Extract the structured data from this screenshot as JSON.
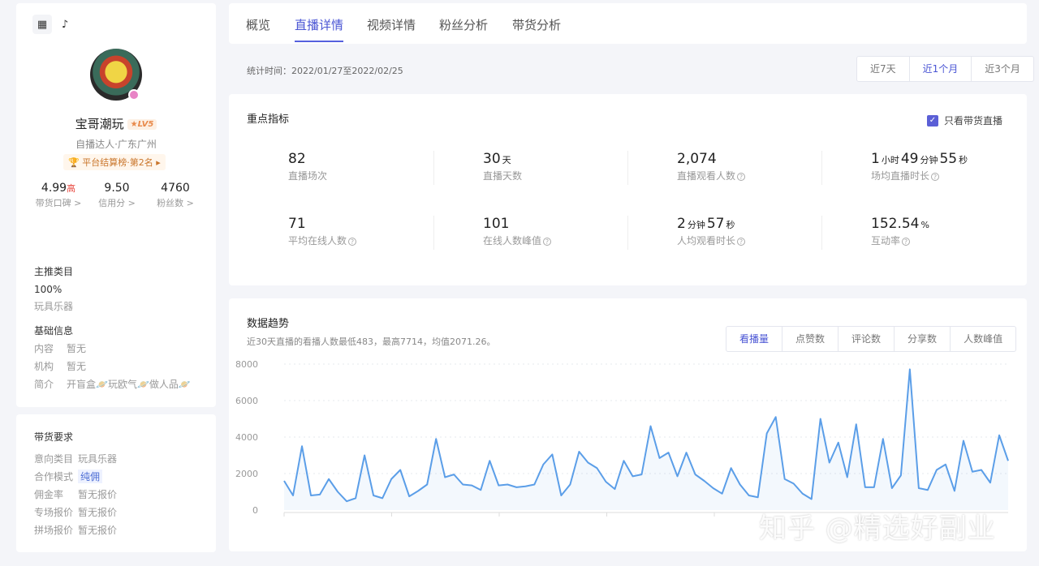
{
  "sidebar": {
    "name": "宝哥潮玩",
    "level": "LV5",
    "subtitle": "自播达人·广东广州",
    "rank": "平台结算榜·第2名",
    "stats": [
      {
        "value": "4.99",
        "tag": "高",
        "label": "带货口碑 >"
      },
      {
        "value": "9.50",
        "label": "信用分 >"
      },
      {
        "value": "4760",
        "label": "粉丝数 >"
      }
    ],
    "category_title": "主推类目",
    "category_pct": "100%",
    "category_name": "玩具乐器",
    "basic_title": "基础信息",
    "basic": [
      {
        "k": "内容",
        "v": "暂无"
      },
      {
        "k": "机构",
        "v": "暂无"
      },
      {
        "k": "简介",
        "v": "开盲盒🪐玩欧气🪐做人品🪐"
      }
    ],
    "req_title": "带货要求",
    "req": [
      {
        "k": "意向类目",
        "v": "玩具乐器"
      },
      {
        "k": "合作模式",
        "v": "纯佣"
      },
      {
        "k": "佣金率",
        "v": "暂无报价"
      },
      {
        "k": "专场报价",
        "v": "暂无报价"
      },
      {
        "k": "拼场报价",
        "v": "暂无报价"
      }
    ]
  },
  "tabs": [
    "概览",
    "直播详情",
    "视频详情",
    "粉丝分析",
    "带货分析"
  ],
  "date_range": "统计时间：2022/01/27至2022/02/25",
  "range_options": [
    "近7天",
    "近1个月",
    "近3个月"
  ],
  "metrics": {
    "title": "重点指标",
    "checkbox_label": "只看带货直播",
    "items": [
      {
        "parts": [
          [
            "82",
            ""
          ]
        ],
        "label": "直播场次",
        "help": false
      },
      {
        "parts": [
          [
            "30",
            "天"
          ]
        ],
        "label": "直播天数",
        "help": false
      },
      {
        "parts": [
          [
            "2,074",
            ""
          ]
        ],
        "label": "直播观看人数",
        "help": true
      },
      {
        "parts": [
          [
            "1",
            "小时"
          ],
          [
            "49",
            "分钟"
          ],
          [
            "55",
            "秒"
          ]
        ],
        "label": "场均直播时长",
        "help": true
      },
      {
        "parts": [
          [
            "71",
            ""
          ]
        ],
        "label": "平均在线人数",
        "help": true
      },
      {
        "parts": [
          [
            "101",
            ""
          ]
        ],
        "label": "在线人数峰值",
        "help": true
      },
      {
        "parts": [
          [
            "2",
            "分钟"
          ],
          [
            "57",
            "秒"
          ]
        ],
        "label": "人均观看时长",
        "help": true
      },
      {
        "parts": [
          [
            "152.54",
            "%"
          ]
        ],
        "label": "互动率",
        "help": true
      }
    ]
  },
  "trend": {
    "title": "数据趋势",
    "summary": "近30天直播的看播人数最低483，最高7714，均值2071.26。",
    "options": [
      "看播量",
      "点赞数",
      "评论数",
      "分享数",
      "人数峰值"
    ]
  },
  "chart_data": {
    "type": "area",
    "series_name": "看播量",
    "ylim": [
      0,
      8000
    ],
    "yticks": [
      0,
      2000,
      4000,
      6000,
      8000
    ],
    "grid": true,
    "color": "#5b9ee8",
    "values": [
      1600,
      800,
      3500,
      800,
      850,
      1700,
      1000,
      480,
      650,
      3000,
      800,
      650,
      1700,
      2200,
      750,
      1050,
      1400,
      3900,
      1800,
      1950,
      1400,
      1350,
      1100,
      2700,
      1350,
      1400,
      1250,
      1300,
      1400,
      2500,
      3050,
      800,
      1400,
      3200,
      2600,
      2300,
      1550,
      1150,
      2700,
      1850,
      1950,
      4600,
      2850,
      3150,
      1850,
      3150,
      1950,
      1600,
      1200,
      900,
      2300,
      1400,
      800,
      700,
      4200,
      5100,
      1700,
      1450,
      900,
      600,
      5000,
      2600,
      3700,
      1800,
      4700,
      1250,
      1250,
      3900,
      1200,
      1900,
      7714,
      1200,
      1100,
      2200,
      2500,
      1050,
      3800,
      2100,
      2200,
      1500,
      4100,
      2700
    ]
  },
  "watermark": "知乎 @精选好副业",
  "colors": {
    "accent": "#4a55d4",
    "line": "#5b9ee8"
  }
}
